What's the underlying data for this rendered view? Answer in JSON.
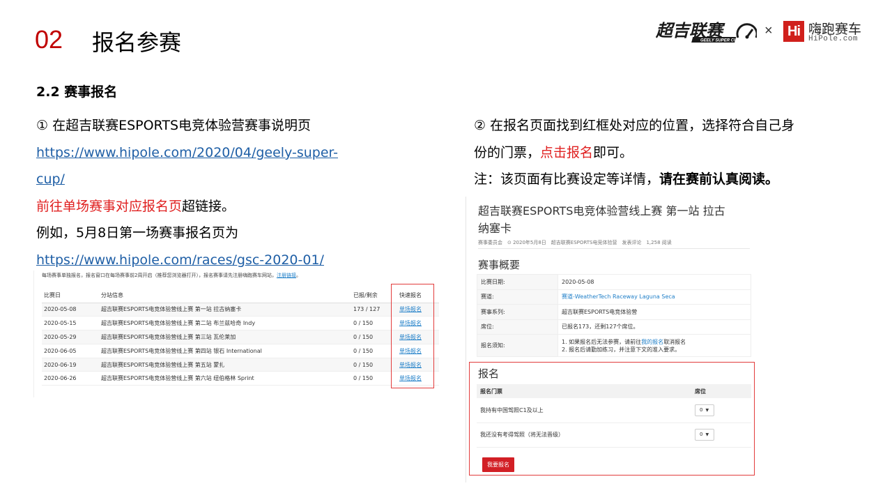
{
  "header": {
    "section_number": "02",
    "section_title": "报名参赛",
    "brand_left_text": "超吉联赛",
    "brand_left_sub": "GEELY SUPER CUP",
    "brand_separator": "×",
    "brand_right_mark": "Hi",
    "brand_right_name": "嗨跑赛车",
    "brand_right_url": "HiPole.com"
  },
  "sub_title": "2.2 赛事报名",
  "left": {
    "line1": "① 在超吉联赛ESPORTS电竞体验营赛事说明页",
    "link1_part1": "https://www.hipole.com/2020/04/geely-super-",
    "link1_part2": "cup/",
    "line3_red": "前往单场赛事对应报名页",
    "line3_rest": "超链接。",
    "line4": "例如，5月8日第一场赛事报名页为",
    "link2": "https://www.hipole.com/races/gsc-2020-01/"
  },
  "right": {
    "line1": "② 在报名页面找到红框处对应的位置，选择符合自己身",
    "line2_a": "份的门票，",
    "line2_red": "点击报名",
    "line2_b": "即可。",
    "note_a": "注：该页面有比赛设定等详情，",
    "note_bold": "请在赛前认真阅读。"
  },
  "race_list": {
    "note_text": "每场赛事单独报名，报名窗口在每场赛事前2周开启（推荐您浏览器打开），报名赛事请先注册嗨跑赛车网站，",
    "note_link": "注册链接",
    "note_end": "。",
    "headers": [
      "比赛日",
      "分站信息",
      "已报/剩余",
      "快速报名"
    ],
    "rows": [
      {
        "date": "2020-05-08",
        "info": "超吉联赛ESPORTS电竞体验营线上赛 第一站 拉古纳塞卡",
        "count": "173 / 127",
        "link": "单场报名"
      },
      {
        "date": "2020-05-15",
        "info": "超吉联赛ESPORTS电竞体验营线上赛 第二站 布兰兹哈奇 Indy",
        "count": "0 / 150",
        "link": "单场报名"
      },
      {
        "date": "2020-05-29",
        "info": "超吉联赛ESPORTS电竞体验营线上赛 第三站 瓦伦莱加",
        "count": "0 / 150",
        "link": "单场报名"
      },
      {
        "date": "2020-06-05",
        "info": "超吉联赛ESPORTS电竞体验营线上赛 第四站 银石 International",
        "count": "0 / 150",
        "link": "单场报名"
      },
      {
        "date": "2020-06-19",
        "info": "超吉联赛ESPORTS电竞体验营线上赛 第五站 蒙扎",
        "count": "0 / 150",
        "link": "单场报名"
      },
      {
        "date": "2020-06-26",
        "info": "超吉联赛ESPORTS电竞体验营线上赛 第六站 纽伯格林 Sprint",
        "count": "0 / 150",
        "link": "单场报名"
      }
    ]
  },
  "race_page": {
    "title_line1": "超吉联赛ESPORTS电竞体验营线上赛 第一站 拉古",
    "title_line2": "纳塞卡",
    "meta": "赛事委员会　⊙ 2020年5月8日　超吉联赛ESPORTS电竞体验营　发表评论　1,258 阅读",
    "overview_title": "赛事概要",
    "overview": {
      "date_label": "比赛日期:",
      "date_value": "2020-05-08",
      "track_label": "赛道:",
      "track_value": "赛道-WeatherTech Raceway Laguna Seca",
      "series_label": "赛事系列:",
      "series_value": "超吉联赛ESPORTS电竞体验营",
      "seats_label": "席位:",
      "seats_value": "已报名173，还剩127个席位。",
      "notice_label": "报名须知:",
      "notice_line1_a": "1. 如果报名后无法参赛，请前往",
      "notice_line1_link": "我的报名",
      "notice_line1_b": "取消报名",
      "notice_line2": "2. 报名后请勤加练习，并注意下文的准入要求。"
    },
    "registration": {
      "title": "报名",
      "col_ticket": "报名门票",
      "col_seat": "席位",
      "tickets": [
        {
          "name": "我持有中国驾照C1及以上",
          "seat": "0"
        },
        {
          "name": "我还没有考得驾照（将无法晋级）",
          "seat": "0"
        }
      ],
      "button": "我要报名"
    }
  },
  "colors": {
    "accent_red": "#c00000",
    "highlight_red": "#e02020",
    "link_blue": "#1f5fa6",
    "box_red": "#e23b3b",
    "button_red": "#d21f25"
  }
}
